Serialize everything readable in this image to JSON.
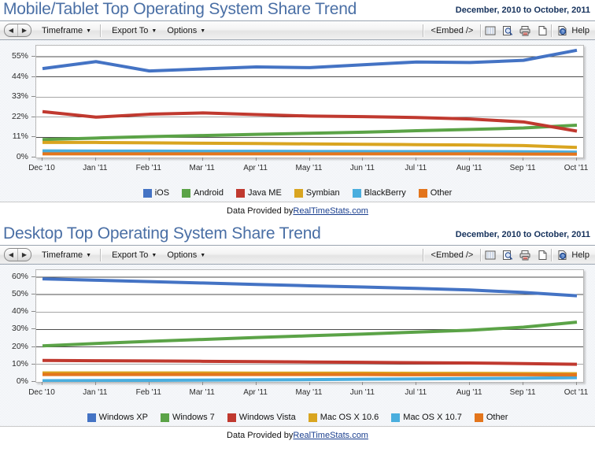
{
  "toolbar": {
    "timeframe_label": "Timeframe",
    "export_label": "Export To",
    "options_label": "Options",
    "embed_label": "<Embed />",
    "help_label": "Help",
    "caret": "▼",
    "prev_arrow": "◀",
    "next_arrow": "▶",
    "icons": [
      "columns-icon",
      "zoom-preview-icon",
      "print-icon",
      "page-icon",
      "help-icon"
    ]
  },
  "footer": {
    "prefix": "Data Provided by ",
    "link": "RealTimeStats.com"
  },
  "panels": [
    {
      "title": "Mobile/Tablet Top Operating System Share Trend",
      "date_range": "December, 2010 to October, 2011"
    },
    {
      "title": "Desktop Top Operating System Share Trend",
      "date_range": "December, 2010 to October, 2011"
    }
  ],
  "chart_data": [
    {
      "type": "line",
      "title": "Mobile/Tablet Top Operating System Share Trend",
      "subtitle": "December, 2010 to October, 2011",
      "xlabel": "",
      "ylabel": "",
      "grid": true,
      "legend_position": "bottom",
      "categories": [
        "Dec '10",
        "Jan '11",
        "Feb '11",
        "Mar '11",
        "Apr '11",
        "May '11",
        "Jun '11",
        "Jul '11",
        "Aug '11",
        "Sep '11",
        "Oct '11"
      ],
      "ylim": [
        0,
        61
      ],
      "yticks": [
        0,
        11,
        22,
        33,
        44,
        55
      ],
      "ytick_labels": [
        "0%",
        "11%",
        "22%",
        "33%",
        "44%",
        "55%"
      ],
      "series": [
        {
          "name": "iOS",
          "color": "#4473c4",
          "values": [
            48.5,
            52.3,
            47.2,
            48.3,
            49.4,
            49.0,
            50.6,
            52.1,
            51.8,
            53.0,
            58.5
          ]
        },
        {
          "name": "Android",
          "color": "#5ba347",
          "values": [
            9.8,
            10.6,
            11.4,
            12.0,
            12.6,
            13.2,
            13.8,
            14.6,
            15.3,
            16.1,
            17.6
          ]
        },
        {
          "name": "Java ME",
          "color": "#c0392f",
          "values": [
            25.0,
            22.0,
            23.6,
            24.3,
            23.4,
            22.6,
            22.3,
            21.8,
            21.0,
            19.4,
            14.4
          ]
        },
        {
          "name": "Symbian",
          "color": "#d9a520",
          "values": [
            8.2,
            8.2,
            8.0,
            7.8,
            7.6,
            7.4,
            7.2,
            7.0,
            6.8,
            6.5,
            5.5
          ]
        },
        {
          "name": "BlackBerry",
          "color": "#4aaede",
          "values": [
            3.6,
            3.5,
            3.5,
            3.4,
            3.4,
            3.3,
            3.3,
            3.2,
            3.2,
            3.1,
            2.9
          ]
        },
        {
          "name": "Other",
          "color": "#e3751c",
          "values": [
            2.0,
            2.0,
            2.0,
            2.0,
            2.0,
            2.0,
            2.0,
            2.0,
            2.0,
            1.9,
            1.8
          ]
        }
      ]
    },
    {
      "type": "line",
      "title": "Desktop Top Operating System Share Trend",
      "subtitle": "December, 2010 to October, 2011",
      "xlabel": "",
      "ylabel": "",
      "grid": true,
      "legend_position": "bottom",
      "categories": [
        "Dec '10",
        "Jan '11",
        "Feb '11",
        "Mar '11",
        "Apr '11",
        "May '11",
        "Jun '11",
        "Jul '11",
        "Aug '11",
        "Sep '11",
        "Oct '11"
      ],
      "ylim": [
        0,
        64
      ],
      "yticks": [
        0,
        10,
        20,
        30,
        40,
        50,
        60
      ],
      "ytick_labels": [
        "0%",
        "10%",
        "20%",
        "30%",
        "40%",
        "50%",
        "60%"
      ],
      "series": [
        {
          "name": "Windows XP",
          "color": "#4473c4",
          "values": [
            59.0,
            58.2,
            57.4,
            56.6,
            55.8,
            55.0,
            54.3,
            53.5,
            52.6,
            51.2,
            49.3
          ]
        },
        {
          "name": "Windows 7",
          "color": "#5ba347",
          "values": [
            20.6,
            22.0,
            23.2,
            24.3,
            25.4,
            26.4,
            27.4,
            28.5,
            29.6,
            31.3,
            34.2
          ]
        },
        {
          "name": "Windows Vista",
          "color": "#c0392f",
          "values": [
            12.3,
            12.1,
            12.0,
            11.8,
            11.6,
            11.4,
            11.2,
            11.0,
            10.8,
            10.5,
            10.1
          ]
        },
        {
          "name": "Mac OS X 10.6",
          "color": "#d9a520",
          "values": [
            5.1,
            5.1,
            5.1,
            5.1,
            5.0,
            5.0,
            5.0,
            4.9,
            4.9,
            4.8,
            4.7
          ]
        },
        {
          "name": "Mac OS X 10.7",
          "color": "#4aaede",
          "values": [
            0.7,
            0.8,
            0.9,
            1.0,
            1.1,
            1.3,
            1.5,
            1.7,
            1.9,
            2.1,
            2.4
          ]
        },
        {
          "name": "Other",
          "color": "#e3751c",
          "values": [
            4.2,
            4.2,
            4.2,
            4.2,
            4.2,
            4.2,
            4.2,
            4.1,
            4.1,
            4.1,
            4.0
          ]
        }
      ]
    }
  ]
}
